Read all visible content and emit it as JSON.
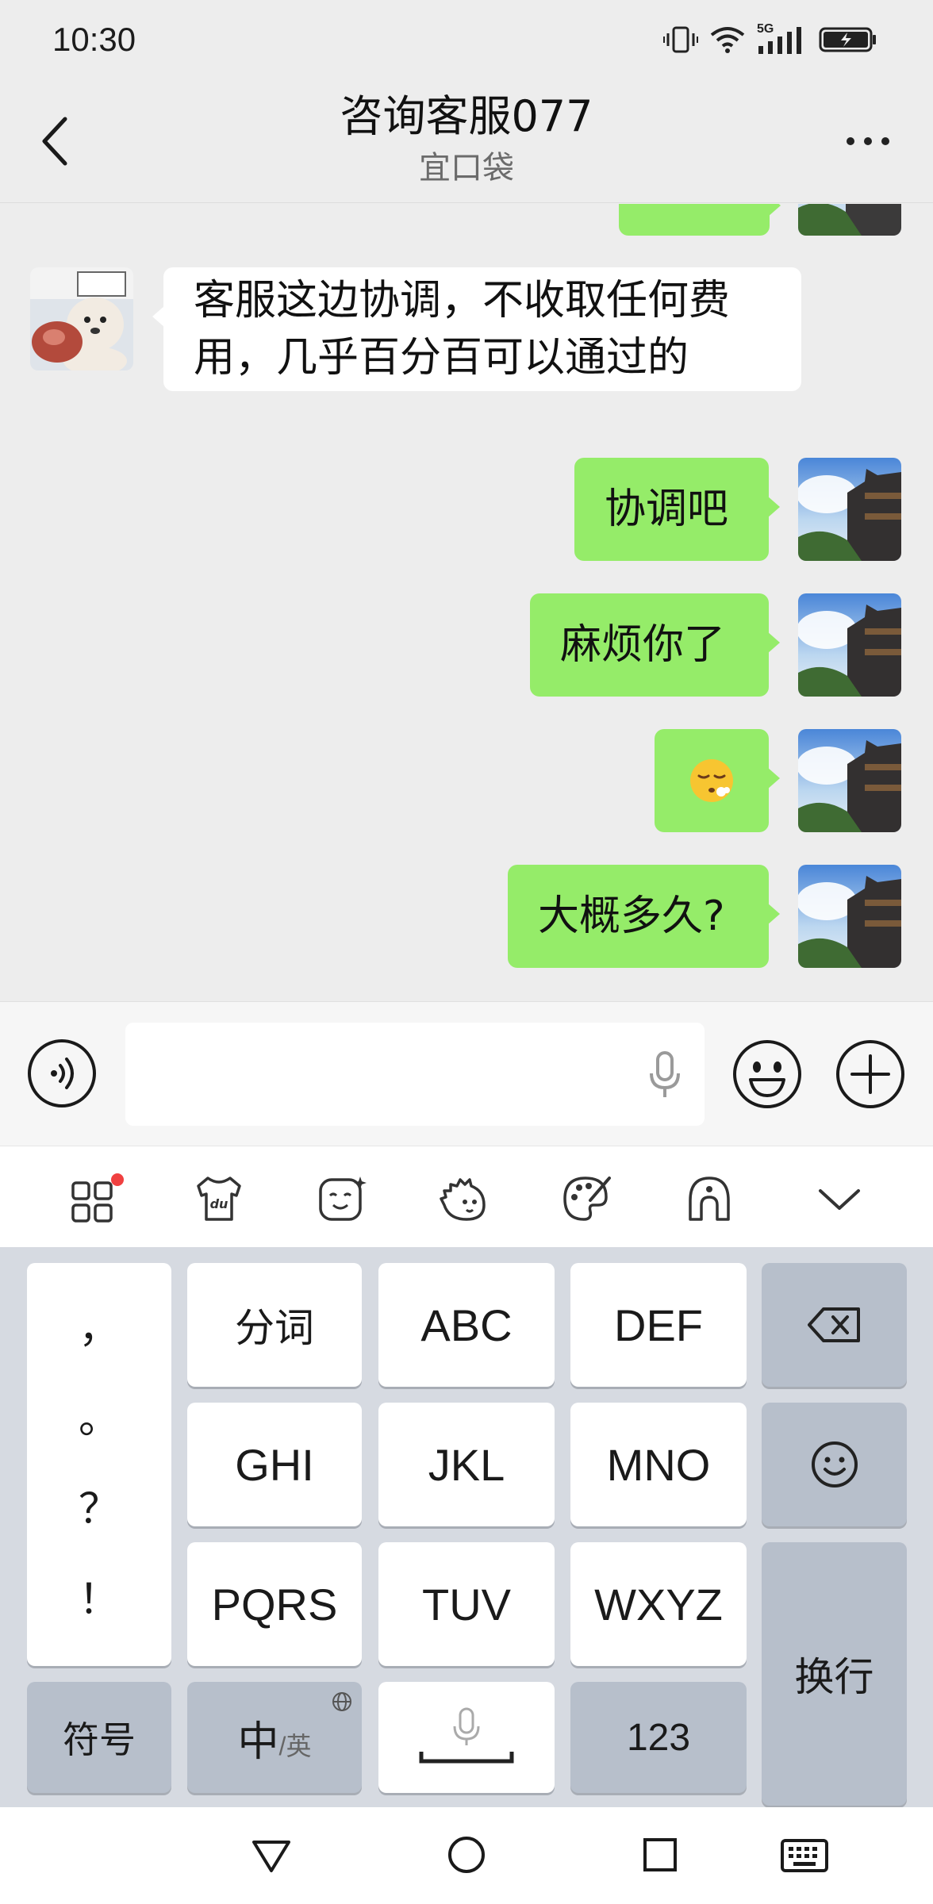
{
  "status_bar": {
    "time": "10:30",
    "network_label": "5G",
    "icons": [
      "vibrate-icon",
      "wifi-icon",
      "signal-icon",
      "battery-icon"
    ]
  },
  "header": {
    "title": "咨询客服077",
    "subtitle": "宜口袋",
    "back_icon": "chevron-left-icon",
    "more_icon": "more-dots-icon"
  },
  "messages": [
    {
      "from": "me",
      "text": "",
      "partial": true
    },
    {
      "from": "other",
      "lines": [
        "客服这边协调，不收取任何费",
        "用，几乎百分百可以通过的"
      ]
    },
    {
      "from": "me",
      "text": "协调吧"
    },
    {
      "from": "me",
      "text": "麻烦你了"
    },
    {
      "from": "me",
      "emoji": "😮‍💨"
    },
    {
      "from": "me",
      "text": "大概多久?"
    }
  ],
  "input_bar": {
    "voice_icon": "voice-mode-icon",
    "value": "",
    "mic_icon": "microphone-icon",
    "emoji_icon": "emoji-icon",
    "plus_icon": "plus-icon"
  },
  "keyboard_toolbar": {
    "icons": [
      "apps-grid-icon",
      "du-shirt-icon",
      "face-sticker-icon",
      "hedgehog-sticker-icon",
      "palette-icon",
      "handwriting-icon",
      "collapse-chevron-icon"
    ]
  },
  "keyboard": {
    "punctuation": [
      "，",
      "。",
      "？",
      "！"
    ],
    "rows": [
      [
        "分词",
        "ABC",
        "DEF"
      ],
      [
        "GHI",
        "JKL",
        "MNO"
      ],
      [
        "PQRS",
        "TUV",
        "WXYZ"
      ]
    ],
    "symbols": "符号",
    "lang_main": "中",
    "lang_alt": "/英",
    "numbers": "123",
    "enter": "换行",
    "backspace_icon": "backspace-icon",
    "emoji_key_icon": "smiley-key-icon",
    "space_icon": "space-bar-icon",
    "globe_icon": "globe-icon"
  },
  "nav_bar": {
    "icons": [
      "back-triangle-icon",
      "home-circle-icon",
      "recents-square-icon",
      "keyboard-icon"
    ]
  },
  "colors": {
    "my_bubble": "#95ec69",
    "other_bubble": "#ffffff",
    "background": "#ededed",
    "notification_dot": "#f04040"
  }
}
